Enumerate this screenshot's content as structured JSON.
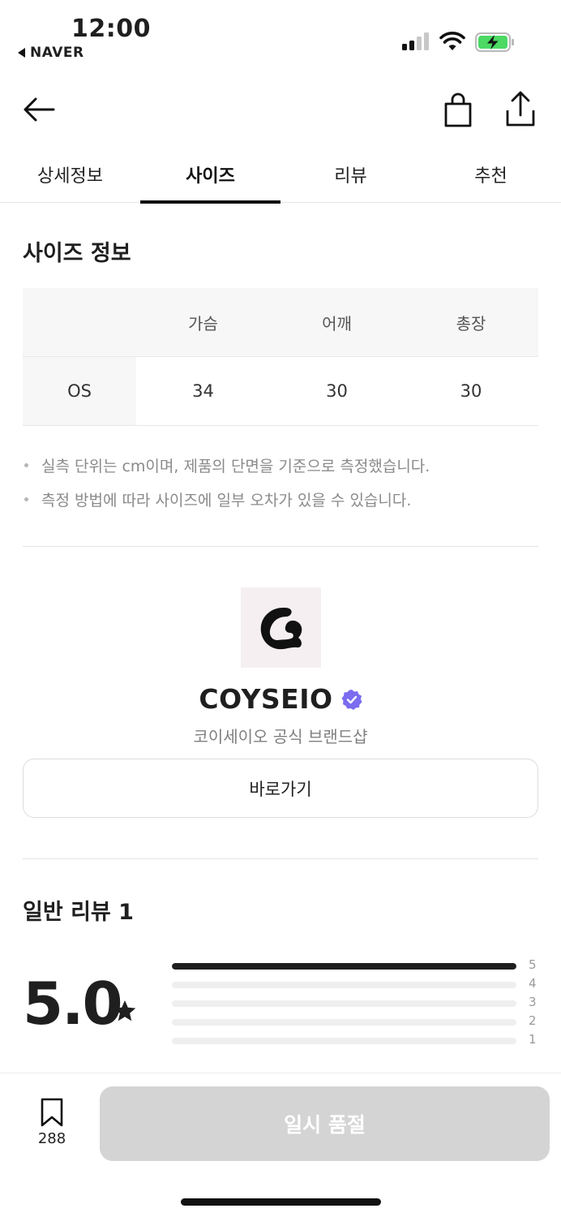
{
  "status_bar": {
    "time": "12:00",
    "back_app": "NAVER"
  },
  "top_nav": {
    "back_icon": "arrow-left-icon",
    "bag_icon": "shopping-bag-icon",
    "share_icon": "share-icon"
  },
  "tabs": [
    {
      "label": "상세정보",
      "active": false
    },
    {
      "label": "사이즈",
      "active": true
    },
    {
      "label": "리뷰",
      "active": false
    },
    {
      "label": "추천",
      "active": false
    }
  ],
  "size_info": {
    "title": "사이즈 정보",
    "headers": [
      "",
      "가슴",
      "어깨",
      "총장"
    ],
    "rows": [
      [
        "OS",
        "34",
        "30",
        "30"
      ]
    ],
    "notes": [
      "실측 단위는 cm이며, 제품의 단면을 기준으로 측정했습니다.",
      "측정 방법에 따라 사이즈에 일부 오차가 있을 수 있습니다."
    ]
  },
  "brand": {
    "name": "COYSEIO",
    "subtitle": "코이세이오 공식 브랜드샵",
    "goto_label": "바로가기",
    "verified_color": "#7b6cf0",
    "logo_bg": "#f6eff2"
  },
  "reviews": {
    "title": "일반 리뷰 1",
    "rating": "5.0",
    "distribution": [
      {
        "star": "5",
        "fraction": 1.0
      },
      {
        "star": "4",
        "fraction": 0
      },
      {
        "star": "3",
        "fraction": 0
      },
      {
        "star": "2",
        "fraction": 0
      },
      {
        "star": "1",
        "fraction": 0
      }
    ]
  },
  "bottom_bar": {
    "bookmark_count": "288",
    "soldout_label": "일시 품절"
  }
}
